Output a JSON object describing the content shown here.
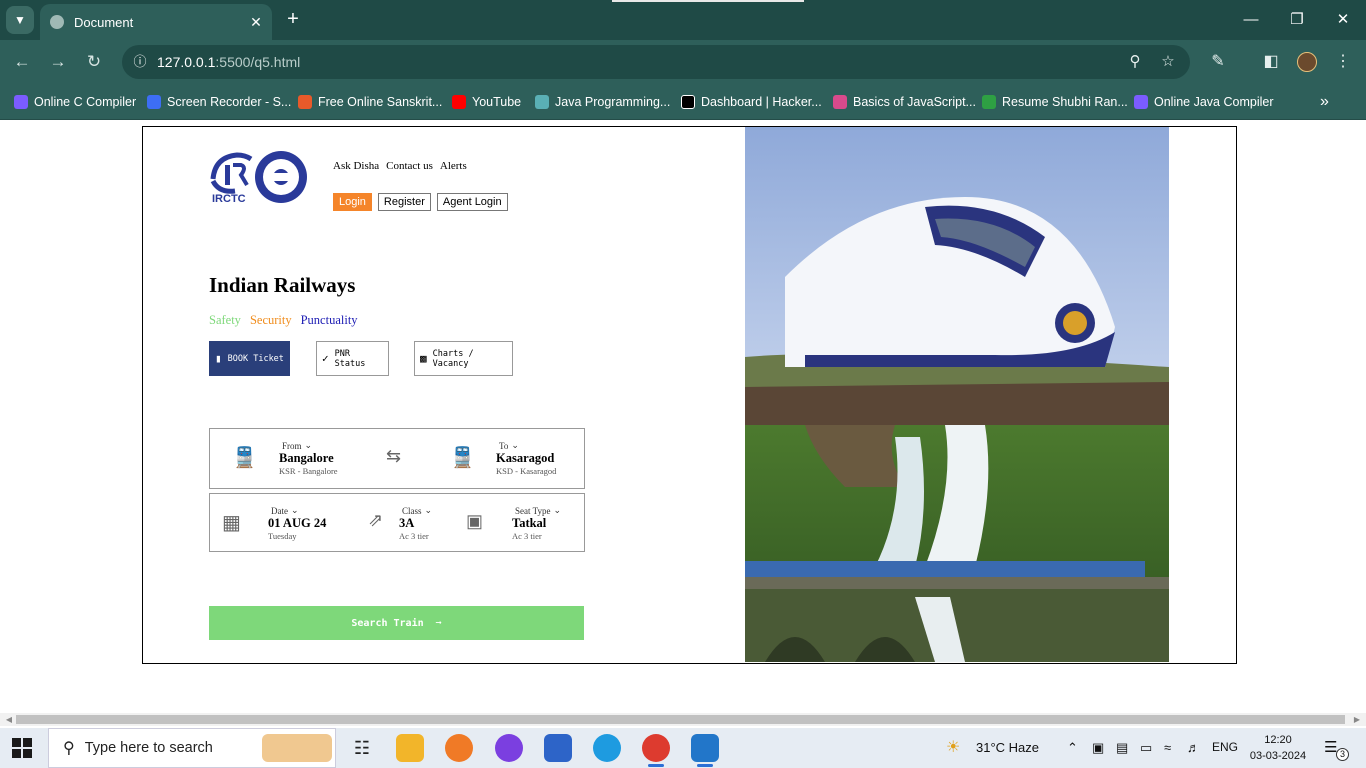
{
  "browser": {
    "tab_title": "Document",
    "url_host": "127.0.0.1",
    "url_rest": ":5500/q5.html",
    "bookmarks": [
      {
        "label": "Online C Compiler",
        "icon": "#7b5cff"
      },
      {
        "label": "Screen Recorder - S...",
        "icon": "#3d6ef5"
      },
      {
        "label": "Free Online Sanskrit...",
        "icon": "#e85a2a"
      },
      {
        "label": "YouTube",
        "icon": "#ff0000"
      },
      {
        "label": "Java Programming...",
        "icon": "#5ab0b5"
      },
      {
        "label": "Dashboard | Hacker...",
        "icon": "#000000"
      },
      {
        "label": "Basics of JavaScript...",
        "icon": "#d94a8c"
      },
      {
        "label": "Resume Shubhi Ran...",
        "icon": "#2ea043"
      },
      {
        "label": "Online Java Compiler",
        "icon": "#7b5cff"
      }
    ]
  },
  "site": {
    "logo_text": "IRCTC",
    "links": [
      "Ask Disha",
      "Contact us",
      "Alerts"
    ],
    "auth": {
      "login": "Login",
      "register": "Register",
      "agent": "Agent Login"
    },
    "headline": "Indian Railways",
    "tags": {
      "safety": "Safety",
      "security": "Security",
      "punctuality": "Punctuality"
    },
    "modes": {
      "book": "BOOK Ticket",
      "pnr": "PNR Status",
      "charts": "Charts / Vacancy"
    },
    "from": {
      "label": "From",
      "value": "Bangalore",
      "sub": "KSR - Bangalore"
    },
    "to": {
      "label": "To",
      "value": "Kasaragod",
      "sub": "KSD - Kasaragod"
    },
    "date": {
      "label": "Date",
      "value": "01 AUG 24",
      "sub": "Tuesday"
    },
    "class": {
      "label": "Class",
      "value": "3A",
      "sub": "Ac 3 tier"
    },
    "seat": {
      "label": "Seat Type",
      "value": "Tatkal",
      "sub": "Ac 3 tier"
    },
    "search_label": "Search Train"
  },
  "taskbar": {
    "search_placeholder": "Type here to search",
    "weather": "31°C  Haze",
    "lang": "ENG",
    "time": "12:20",
    "date": "03-03-2024",
    "notifications": "3"
  },
  "colors": {
    "accent_orange": "#f5852a",
    "safety_green": "#7ed87a",
    "book_blue": "#2a3f7a",
    "chrome_teal": "#2e5f5a"
  }
}
